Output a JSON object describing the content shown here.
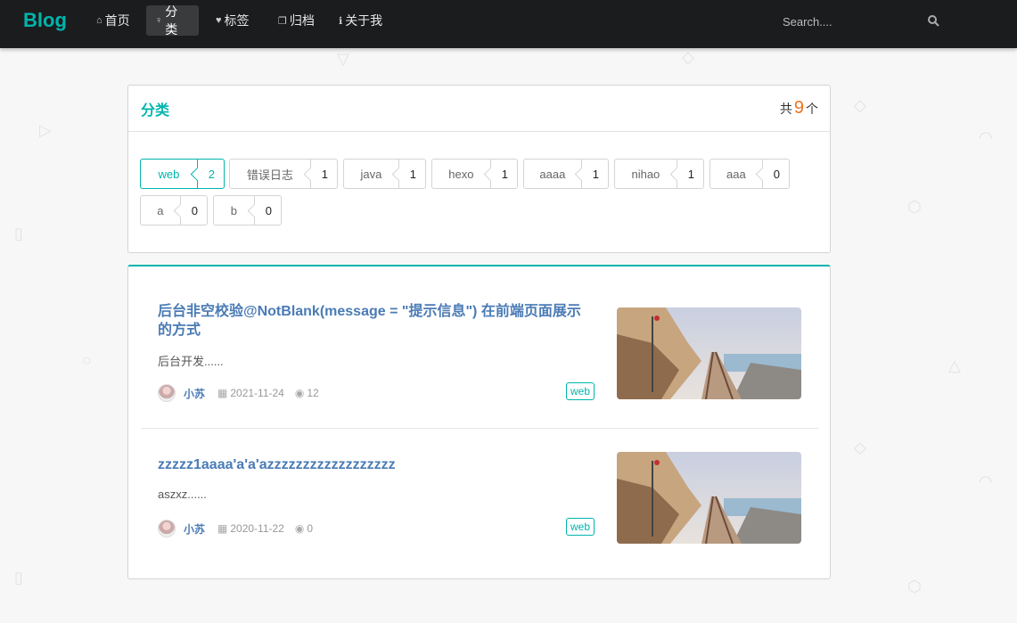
{
  "brand": "Blog",
  "nav": {
    "items": [
      {
        "label": "首页",
        "icon": "home-icon"
      },
      {
        "label": "分类",
        "icon": "idea-icon",
        "active": true
      },
      {
        "label": "标签",
        "icon": "tags-icon"
      },
      {
        "label": "归档",
        "icon": "clone-icon"
      },
      {
        "label": "关于我",
        "icon": "info-icon"
      }
    ],
    "search_placeholder": "Search....",
    "search_icon": "search-icon"
  },
  "categories_card": {
    "title": "分类",
    "count_prefix": "共",
    "count": "9",
    "count_suffix": "个",
    "items": [
      {
        "name": "web",
        "count": "2",
        "active": true
      },
      {
        "name": "错误日志",
        "count": "1"
      },
      {
        "name": "java",
        "count": "1"
      },
      {
        "name": "hexo",
        "count": "1"
      },
      {
        "name": "aaaa",
        "count": "1"
      },
      {
        "name": "nihao",
        "count": "1"
      },
      {
        "name": "aaa",
        "count": "0"
      },
      {
        "name": "a",
        "count": "0"
      },
      {
        "name": "b",
        "count": "0"
      }
    ]
  },
  "posts": [
    {
      "title": "后台非空校验@NotBlank(message = \"提示信息\") 在前端页面展示的方式",
      "description": "后台开发......",
      "author": "小苏",
      "date": "2021-11-24",
      "views": "12",
      "tag": "web"
    },
    {
      "title": "zzzzz1aaaa'a'a'azzzzzzzzzzzzzzzzzz",
      "description": "aszxz......",
      "author": "小苏",
      "date": "2020-11-22",
      "views": "0",
      "tag": "web"
    }
  ],
  "colors": {
    "accent": "#00b5ad",
    "link": "#4a7bb5",
    "count": "#f2711c",
    "navbar": "#1b1c1d"
  }
}
